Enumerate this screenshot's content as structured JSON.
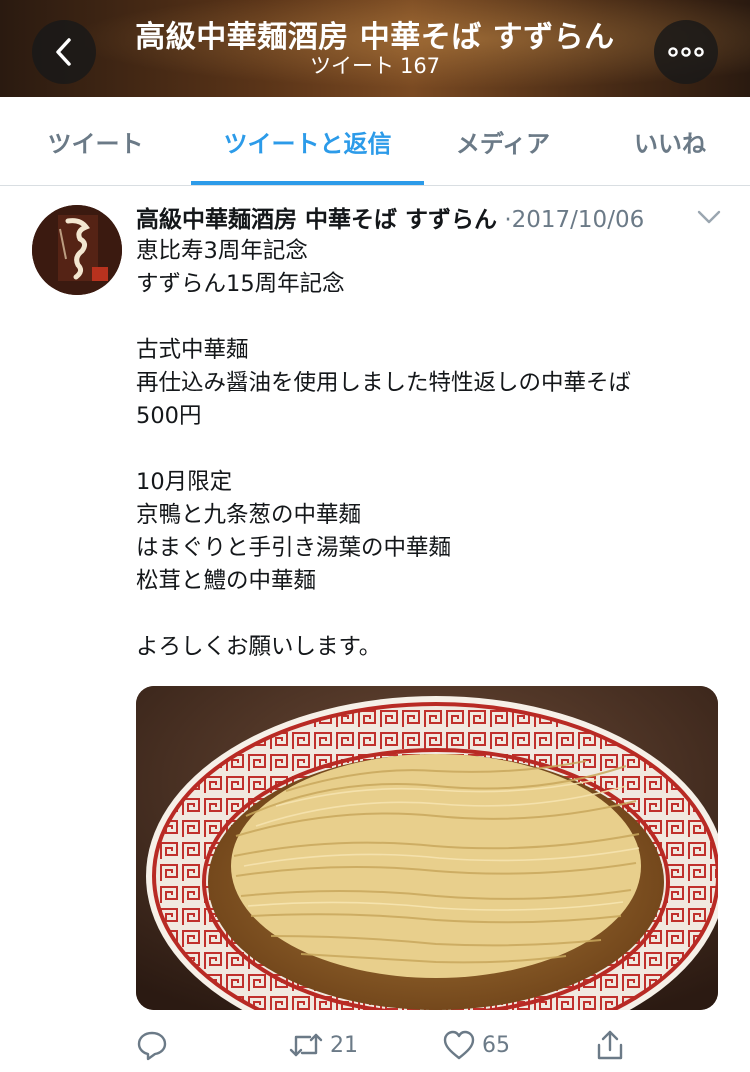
{
  "header": {
    "title": "高級中華麺酒房 中華そば すずらん",
    "tweet_count_label": "ツイート",
    "tweet_count": "167",
    "back_icon": "chevron-left-icon",
    "more_icon": "more-horizontal-icon"
  },
  "tabs": [
    {
      "label": "ツイート",
      "active": false
    },
    {
      "label": "ツイートと返信",
      "active": true
    },
    {
      "label": "メディア",
      "active": false
    },
    {
      "label": "いいね",
      "active": false
    }
  ],
  "tweet": {
    "author": "高級中華麺酒房 中華そば すずらん",
    "separator": "·",
    "date": "2017/10/06",
    "body_lines": [
      "恵比寿3周年記念",
      "すずらん15周年記念",
      "",
      "古式中華麺",
      "再仕込み醤油を使用しました特性返しの中華そば",
      "500円",
      "",
      "10月限定",
      "京鴨と九条葱の中華麺",
      "はまぐりと手引き湯葉の中華麺",
      "松茸と鱧の中華麺",
      "",
      "よろしくお願いします。"
    ],
    "actions": {
      "reply": {
        "icon": "reply-icon",
        "count": ""
      },
      "retweet": {
        "icon": "retweet-icon",
        "count": "21"
      },
      "like": {
        "icon": "heart-icon",
        "count": "65"
      },
      "share": {
        "icon": "share-icon",
        "count": ""
      }
    }
  },
  "colors": {
    "accent": "#2c9be9",
    "secondary_text": "#6b7a87",
    "primary_text": "#14171a"
  }
}
